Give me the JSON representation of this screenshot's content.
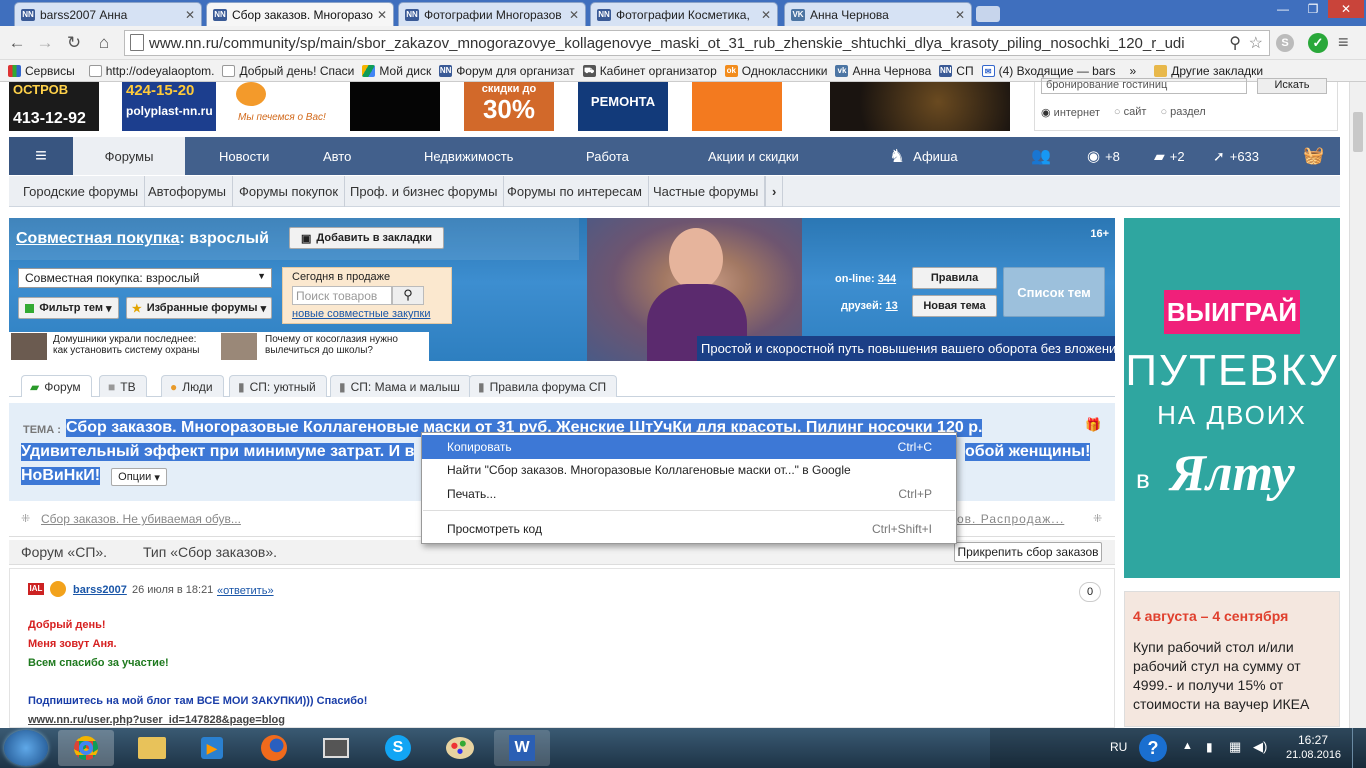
{
  "browser": {
    "tabs": [
      {
        "label": "barss2007 Анна",
        "icon": "nn-favicon"
      },
      {
        "label": "Сбор заказов. Многоразо",
        "icon": "nn-favicon",
        "active": true
      },
      {
        "label": "Фотографии Многоразов",
        "icon": "nn-favicon"
      },
      {
        "label": "Фотографии Косметика,",
        "icon": "nn-favicon"
      },
      {
        "label": "Анна Чернова",
        "icon": "vk-favicon"
      }
    ],
    "url": "www.nn.ru/community/sp/main/sbor_zakazov_mnogorazovye_kollagenovye_maski_ot_31_rub_zhenskie_shtuchki_dlya_krasoty_piling_nosochki_120_r_udi",
    "bookmarks": [
      {
        "label": "Сервисы",
        "icon": "apps-icon"
      },
      {
        "label": "http://odeyalaoptom.",
        "icon": "page-icon"
      },
      {
        "label": "Добрый день! Спаси",
        "icon": "page-icon"
      },
      {
        "label": "Мой диск",
        "icon": "drive-icon"
      },
      {
        "label": "Форум для организат",
        "icon": "nn-favicon"
      },
      {
        "label": "Кабинет организатор",
        "icon": "cart-icon"
      },
      {
        "label": "Одноклассники",
        "icon": "ok-icon"
      },
      {
        "label": "Анна Чернова",
        "icon": "vk-icon"
      },
      {
        "label": "СП",
        "icon": "nn-favicon"
      },
      {
        "label": "(4) Входящие — bars",
        "icon": "mail-icon"
      }
    ],
    "bookmarks_more": "»",
    "other_bookmarks": "Другие закладки"
  },
  "header": {
    "ads": {
      "phone": "413-12-92",
      "phone2": "424-15-20",
      "site": "polyplast-nn.ru",
      "promo": "скидки до",
      "promo_pct": "30%",
      "repair": "РЕМОНТА",
      "greeting": "Мы печемся о Вас!",
      "island": "ОСТРОВ"
    },
    "search": {
      "value": "бронирование гостиниц",
      "button": "Искать",
      "options": [
        "интернет",
        "сайт",
        "раздел"
      ]
    }
  },
  "mainnav": {
    "items": [
      "Форумы",
      "Новости",
      "Авто",
      "Недвижимость",
      "Работа",
      "Акции и скидки",
      "Афиша"
    ],
    "counters": {
      "views": "+8",
      "comments": "+2",
      "rating": "+633"
    }
  },
  "subnav": {
    "items": [
      "Городские форумы",
      "Автофорумы",
      "Форумы покупок",
      "Проф. и бизнес форумы",
      "Форумы по интересам",
      "Частные форумы"
    ]
  },
  "banner": {
    "title_link": "Совместная покупка",
    "title_rest": ": взрослый",
    "bookmark_btn": "Добавить в закладки",
    "age": "16+",
    "select_value": "Совместная покупка: взрослый",
    "filter_btn": "Фильтр тем",
    "fav_btn": "Избранные форумы",
    "today_label": "Сегодня в продаже",
    "search_placeholder": "Поиск товаров",
    "new_purchases": "новые совместные закупки",
    "online_label": "on-line:",
    "online_count": "344",
    "friends_label": "друзей:",
    "friends_count": "13",
    "rules_btn": "Правила",
    "new_topic_btn": "Новая тема",
    "list_btn": "Список тем",
    "news1": "Домушники украли последнее: как установить систему охраны",
    "news2": "Почему от косоглазия нужно вылечиться до школы?",
    "slogan": "Простой и скоростной путь повышения вашего оборота без вложений!"
  },
  "forum_tabs": [
    "Форум",
    "ТВ",
    "Люди",
    "СП: уютный",
    "СП: Мама и малыш",
    "Правила форума СП"
  ],
  "topic": {
    "label": "ТЕМА :",
    "line1": "Сбор заказов. Многоразовые Коллагеновые маски от 31 руб. Женские ШтУчКи для красоты. Пилинг носочки 120 р.",
    "line2a": "Удивительный эффект при минимуме затрат. И в",
    "line2b": "обой женщины!",
    "line3": "НоВиНкИ!",
    "options": "Опции",
    "prev": "Сбор заказов. Не убиваемая обув...",
    "next": "ов. Распродаж..."
  },
  "context_menu": {
    "items": [
      {
        "label": "Копировать",
        "shortcut": "Ctrl+C"
      },
      {
        "label": "Найти \"Сбор заказов. Многоразовые Коллагеновые маски от...\" в Google",
        "shortcut": ""
      },
      {
        "label": "Печать...",
        "shortcut": "Ctrl+P"
      },
      {
        "label": "Просмотреть код",
        "shortcut": "Ctrl+Shift+I"
      }
    ]
  },
  "crumbs": {
    "forum": "Форум «СП».",
    "type": "Тип «Сбор заказов».",
    "pin_btn": "Прикрепить сбор заказов"
  },
  "post": {
    "author": "barss2007",
    "date": "26 июля в 18:21",
    "reply": "«ответить»",
    "votes": "0",
    "l1": "Добрый день!",
    "l2": "Меня зовут Аня.",
    "l3": "Всем спасибо за участие!",
    "l4": "Подпишитесь на мой блог там ВСЕ МОИ ЗАКУПКИ))) Спасибо!",
    "l5": "www.nn.ru/user.php?user_id=147828&page=blog"
  },
  "side_ads": {
    "ad1_l1": "ВЫИГРАЙ",
    "ad1_l2": "ПУТЕВКУ",
    "ad1_l3": "НА ДВОИХ",
    "ad1_l4": "в",
    "ad1_l5": "Ялту",
    "ad2_title": "4 августа – 4 сентября",
    "ad2_text": "Купи рабочий стол и/или рабочий стул на сумму от 4999.- и получи 15% от стоимости на ваучер ИКЕА"
  },
  "taskbar": {
    "lang": "RU",
    "time": "16:27",
    "date": "21.08.2016",
    "apps": [
      "chrome-icon",
      "explorer-icon",
      "media-icon",
      "firefox-icon",
      "app-icon",
      "skype-icon",
      "paint-icon",
      "word-icon"
    ]
  },
  "colors": {
    "selection": "#3d78d6",
    "nav": "#42608c",
    "link": "#1a56a8"
  }
}
